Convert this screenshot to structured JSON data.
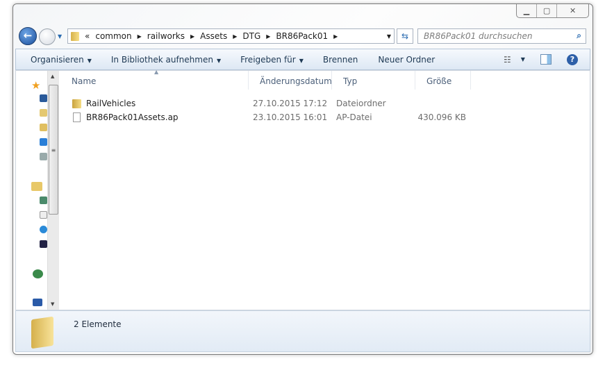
{
  "address": {
    "overflow": "«",
    "crumbs": [
      "common",
      "railworks",
      "Assets",
      "DTG",
      "BR86Pack01"
    ]
  },
  "search": {
    "placeholder": "BR86Pack01 durchsuchen"
  },
  "toolbar": {
    "organize": "Organisieren",
    "library": "In Bibliothek aufnehmen",
    "share": "Freigeben für",
    "burn": "Brennen",
    "new_folder": "Neuer Ordner"
  },
  "columns": {
    "name": "Name",
    "date": "Änderungsdatum",
    "type": "Typ",
    "size": "Größe"
  },
  "files": [
    {
      "name": "RailVehicles",
      "date": "27.10.2015 17:12",
      "type": "Dateiordner",
      "size": ""
    },
    {
      "name": "BR86Pack01Assets.ap",
      "date": "23.10.2015 16:01",
      "type": "AP-Datei",
      "size": "430.096 KB"
    }
  ],
  "status": {
    "count": "2 Elemente"
  }
}
